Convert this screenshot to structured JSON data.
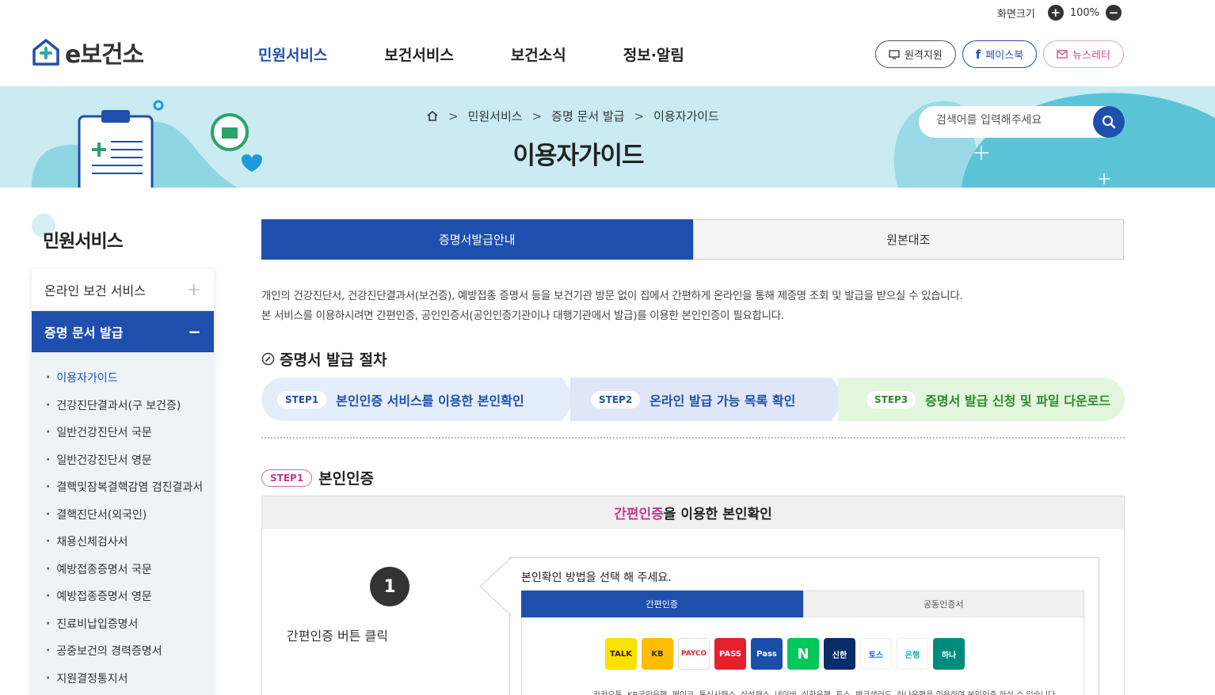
{
  "utility": {
    "zoom_label": "화면크기",
    "zoom_value": "100%",
    "zoom_in": "+",
    "zoom_out": "−"
  },
  "header": {
    "logo_text": "e보건소",
    "nav": [
      "민원서비스",
      "보건서비스",
      "보건소식",
      "정보·알림"
    ],
    "buttons": {
      "remote": "원격지원",
      "facebook": "페이스북",
      "newsletter": "뉴스레터"
    }
  },
  "banner": {
    "breadcrumb": [
      "민원서비스",
      "증명 문서 발급",
      "이용자가이드"
    ],
    "title": "이용자가이드",
    "search_placeholder": "검색어를 입력해주세요"
  },
  "sidebar": {
    "title": "민원서비스",
    "groups": [
      {
        "label": "온라인 보건 서비스",
        "toggle": "+"
      },
      {
        "label": "증명 문서 발급",
        "toggle": "−"
      }
    ],
    "sub_items": [
      "이용자가이드",
      "건강진단결과서(구 보건증)",
      "일반건강진단서 국문",
      "일반건강진단서 영문",
      "결핵및잠복결핵감염 검진결과서",
      "결핵진단서(외국인)",
      "채용신체검사서",
      "예방접종증명서 국문",
      "예방접종증명서 영문",
      "진료비납입증명서",
      "공중보건의 경력증명서",
      "지원결정통지서"
    ]
  },
  "main": {
    "tabs": [
      "증명서발급안내",
      "원본대조"
    ],
    "intro": [
      "개인의 건강진단서, 건강진단결과서(보건증), 예방접종 증명서 등을 보건기관 방문 없이 집에서 간편하게 온라인을 통해 제증명 조회 및 발급을 받으실 수 있습니다.",
      "본 서비스를 이용하시려면 간편인증, 공인인증서(공인인증기관이나 대행기관에서 발급)를 이용한 본인인증이 필요합니다."
    ],
    "procedure_title": "증명서 발급 절차",
    "steps": [
      {
        "badge": "STEP1",
        "label": "본인인증 서비스를 이용한 본인확인"
      },
      {
        "badge": "STEP2",
        "label": "온라인 발급 가능 목록 확인"
      },
      {
        "badge": "STEP3",
        "label": "증명서 발급 신청 및 파일 다운로드"
      }
    ],
    "step1": {
      "badge": "STEP1",
      "title": "본인인증",
      "box_title_highlight": "간편인증",
      "box_title_rest": "을 이용한 본인확인",
      "number": "1",
      "desc": "간편인증 버튼 클릭",
      "popup": {
        "title": "본인확인 방법을 선택 해 주세요.",
        "tabs": [
          "간편인증",
          "공동인증서"
        ],
        "providers": [
          "TALK",
          "KB",
          "PAYCO",
          "PASS",
          "Pass",
          "N",
          "신한",
          "토스",
          "은행",
          "하나"
        ],
        "note": "카카오톡, KB국민은행, 페이코, 통신사패스, 삼성패스, 네이버, 신한은행, 토스, 뱅크샐러드, 하나은행을 이용하여 본인인증 하실 수 있습니다."
      }
    }
  },
  "colors": {
    "primary": "#1f4fad",
    "banner": "#c9ebf1",
    "accent_pink": "#c23b86",
    "step3_green": "#2d8a2d"
  }
}
